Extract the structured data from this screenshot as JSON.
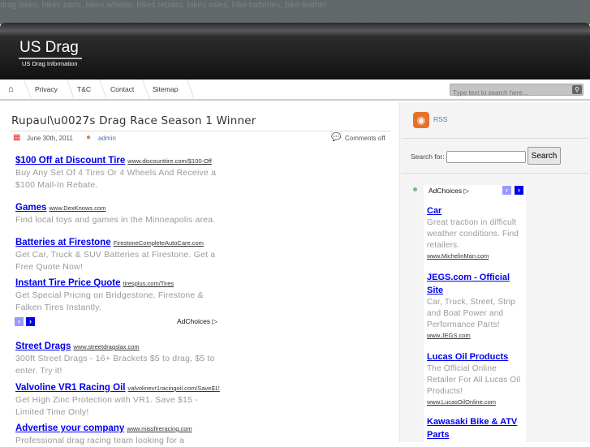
{
  "top_tags": "drag bikes, bikes parts, bikes wheels, bikes repairs, bikes sales, bike batteries, bike leather",
  "site": {
    "title": "US Drag",
    "tagline": "US Drag Information"
  },
  "nav": {
    "items": [
      "Privacy",
      "T&C",
      "Contact",
      "Sitemap"
    ],
    "search_placeholder": "Type text to search here..."
  },
  "post": {
    "title": "Rupaul\\u0027s Drag Race Season 1 Winner",
    "date": "June 30th, 2011",
    "author": "admin",
    "comments": "Comments off"
  },
  "main_ads": [
    {
      "title": "$100 Off at Discount Tire",
      "url": "www.discounttire.com/$100-Off",
      "desc": "Buy Any Set Of 4 Tires Or 4 Wheels And Receive a $100 Mail-In Rebate."
    },
    {
      "title": "Games",
      "url": "www.DexKnows.com",
      "desc": "Find local toys and games in the Minneapolis area."
    },
    {
      "title": "Batteries at Firestone",
      "url": "FirestoneCompleteAutoCare.com",
      "desc": "Get Car, Truck & SUV Batteries at Firestone. Get a Free Quote Now!"
    },
    {
      "title": "Instant Tire Price Quote",
      "url": "tiresplus.com/Tires",
      "desc": "Get Special Pricing on Bridgestone, Firestone & Falken Tires Instantly."
    },
    {
      "title": "Street Drags",
      "url": "www.streetdragslax.com",
      "desc": "300ft Street Drags - 16+ Brackets $5 to drag, $5 to enter. Try it!"
    },
    {
      "title": "Valvoline VR1 Racing Oil",
      "url": "valvolinevr1racingoil.com/Save$1!",
      "desc": "Get High Zinc Protection with VR1. Save $15 - Limited Time Only!"
    },
    {
      "title": "Advertise your company",
      "url": "www.missfireracing.com",
      "desc": "Professional drag racing team looking for a"
    }
  ],
  "adchoices": "AdChoices",
  "sidebar": {
    "rss": "RSS",
    "search_label": "Search for:",
    "search_button": "Search",
    "ads": [
      {
        "title": "Car",
        "desc": "Great traction in difficult weather conditions. Find retailers.",
        "url": "www.MichelinMan.com"
      },
      {
        "title": "JEGS.com - Official Site",
        "desc": "Car, Truck, Street, Strip and Boat Power and Performance Parts!",
        "url": "www.JEGS.com"
      },
      {
        "title": "Lucas Oil Products",
        "desc": "The Official Online Retailer For All Lucas Oil Products!",
        "url": "www.LucasOilOnline.com"
      },
      {
        "title": "Kawasaki Bike & ATV Parts"
      }
    ]
  },
  "colors": {
    "link": "#0000ee",
    "desc": "#9a9a9a",
    "header": "#1c1c1c",
    "sidebar_bg": "#f4f4f4"
  }
}
